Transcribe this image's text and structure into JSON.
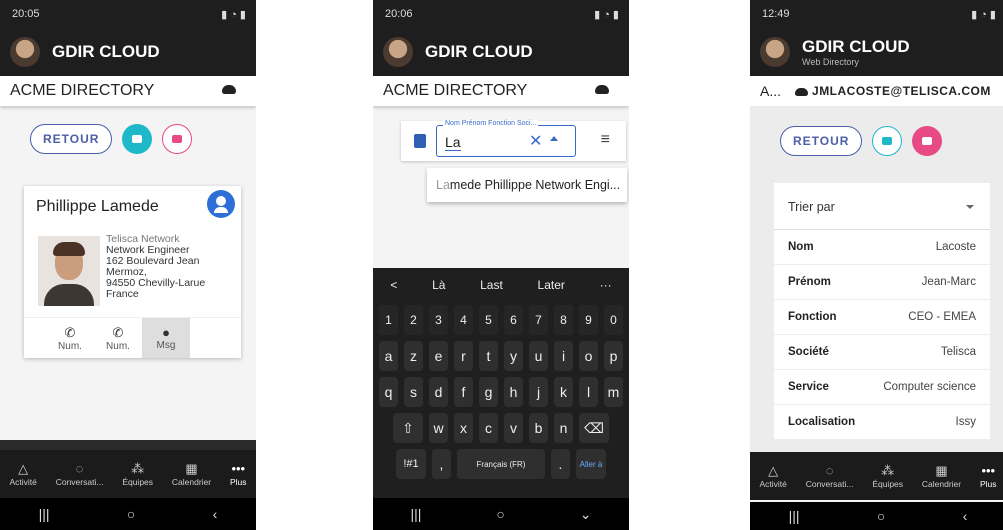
{
  "colors": {
    "accent_blue": "#4b5ea8",
    "teal": "#1fb8c9",
    "pink": "#e84a86",
    "dark": "#1e1e1e"
  },
  "phone1": {
    "status_time": "20:05",
    "app_title": "GDIR CLOUD",
    "directory_title": "ACME DIRECTORY",
    "retour_label": "RETOUR",
    "card": {
      "name": "Phillippe Lamede",
      "company": "Telisca Network",
      "job": "Network Engineer",
      "address_1": "162 Boulevard Jean",
      "address_2": "Mermoz,",
      "address_3": "94550 Chevilly-Larue",
      "country": "France",
      "actions": [
        {
          "label": "Num.",
          "icon": "phone-icon"
        },
        {
          "label": "Num.",
          "icon": "phone-icon"
        },
        {
          "label": "Msg",
          "icon": "chat-icon"
        }
      ]
    },
    "nav": [
      {
        "label": "Activité",
        "icon": "bell-icon"
      },
      {
        "label": "Conversati...",
        "icon": "chat-bubble-icon"
      },
      {
        "label": "Équipes",
        "icon": "teams-icon"
      },
      {
        "label": "Calendrier",
        "icon": "calendar-icon"
      },
      {
        "label": "Plus",
        "icon": "more-icon"
      }
    ]
  },
  "phone2": {
    "status_time": "20:06",
    "app_title": "GDIR CLOUD",
    "directory_title": "ACME DIRECTORY",
    "search_label": "Nom Prénom Fonction Soci...",
    "search_value": "La",
    "suggestion_match": "La",
    "suggestion_rest": "mede Phillippe Network Engi...",
    "keyboard": {
      "suggestions": [
        "<",
        "Là",
        "Last",
        "Later",
        "···"
      ],
      "digits": [
        "1",
        "2",
        "3",
        "4",
        "5",
        "6",
        "7",
        "8",
        "9",
        "0"
      ],
      "row1": [
        "a",
        "z",
        "e",
        "r",
        "t",
        "y",
        "u",
        "i",
        "o",
        "p"
      ],
      "row2": [
        "q",
        "s",
        "d",
        "f",
        "g",
        "h",
        "j",
        "k",
        "l",
        "m"
      ],
      "row3": [
        "w",
        "x",
        "c",
        "v",
        "b",
        "n"
      ],
      "symbols": "!#1",
      "comma": ",",
      "space": "Français (FR)",
      "period": ".",
      "action": "Aller à"
    }
  },
  "phone3": {
    "status_time": "12:49",
    "app_title": "GDIR CLOUD",
    "app_subtitle": "Web Directory",
    "directory_short": "A...",
    "email": "JMLACOSTE@TELISCA.COM",
    "retour_label": "RETOUR",
    "sort_label": "Trier par",
    "rows": [
      {
        "key": "Nom",
        "value": "Lacoste"
      },
      {
        "key": "Prénom",
        "value": "Jean-Marc"
      },
      {
        "key": "Fonction",
        "value": "CEO - EMEA"
      },
      {
        "key": "Société",
        "value": "Telisca"
      },
      {
        "key": "Service",
        "value": "Computer science"
      },
      {
        "key": "Localisation",
        "value": "Issy"
      }
    ],
    "nav": [
      {
        "label": "Activité",
        "icon": "bell-icon"
      },
      {
        "label": "Conversati...",
        "icon": "chat-bubble-icon"
      },
      {
        "label": "Équipes",
        "icon": "teams-icon"
      },
      {
        "label": "Calendrier",
        "icon": "calendar-icon"
      },
      {
        "label": "Plus",
        "icon": "more-icon"
      }
    ]
  }
}
